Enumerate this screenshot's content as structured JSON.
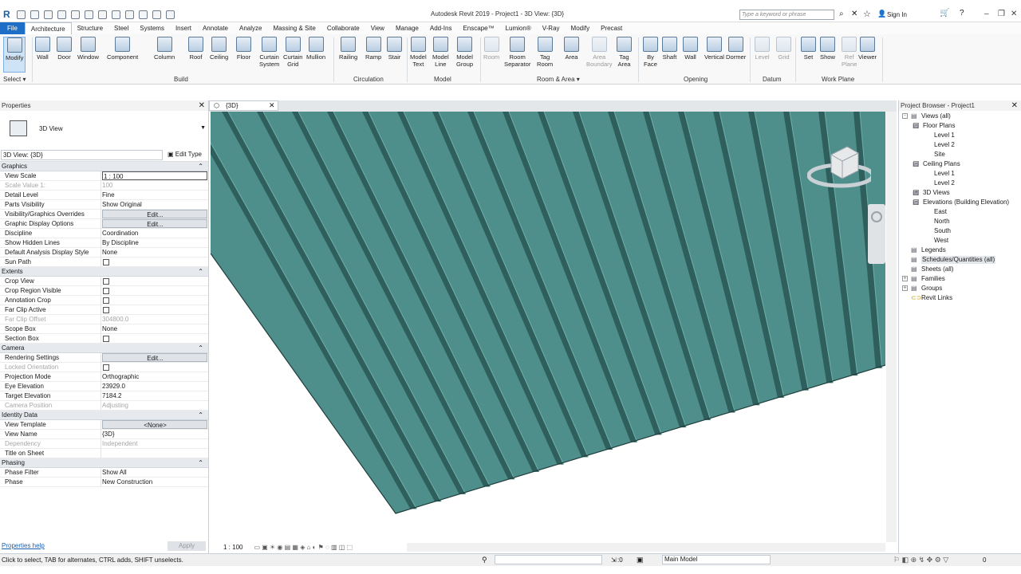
{
  "app": {
    "title": "Autodesk Revit 2019 - Project1 - 3D View: {3D}",
    "search_placeholder": "Type a keyword or phrase",
    "sign_in": "Sign In"
  },
  "tabs": [
    "File",
    "Architecture",
    "Structure",
    "Steel",
    "Systems",
    "Insert",
    "Annotate",
    "Analyze",
    "Massing & Site",
    "Collaborate",
    "View",
    "Manage",
    "Add-Ins",
    "Enscape™",
    "Lumion®",
    "V-Ray",
    "Modify",
    "Precast"
  ],
  "ribbon": {
    "buttons": [
      {
        "l1": "Modify",
        "l2": "",
        "enabled": true
      },
      {
        "l1": "Wall",
        "l2": "",
        "enabled": true
      },
      {
        "l1": "Door",
        "l2": "",
        "enabled": true
      },
      {
        "l1": "Window",
        "l2": "",
        "enabled": true
      },
      {
        "l1": "Component",
        "l2": "",
        "enabled": true
      },
      {
        "l1": "Column",
        "l2": "",
        "enabled": true
      },
      {
        "l1": "Roof",
        "l2": "",
        "enabled": true
      },
      {
        "l1": "Ceiling",
        "l2": "",
        "enabled": true
      },
      {
        "l1": "Floor",
        "l2": "",
        "enabled": true
      },
      {
        "l1": "Curtain",
        "l2": "System",
        "enabled": true
      },
      {
        "l1": "Curtain",
        "l2": "Grid",
        "enabled": true
      },
      {
        "l1": "Mullion",
        "l2": "",
        "enabled": true
      },
      {
        "l1": "Railing",
        "l2": "",
        "enabled": true
      },
      {
        "l1": "Ramp",
        "l2": "",
        "enabled": true
      },
      {
        "l1": "Stair",
        "l2": "",
        "enabled": true
      },
      {
        "l1": "Model",
        "l2": "Text",
        "enabled": true
      },
      {
        "l1": "Model",
        "l2": "Line",
        "enabled": true
      },
      {
        "l1": "Model",
        "l2": "Group",
        "enabled": true
      },
      {
        "l1": "Room",
        "l2": "",
        "enabled": false
      },
      {
        "l1": "Room",
        "l2": "Separator",
        "enabled": true
      },
      {
        "l1": "Tag",
        "l2": "Room",
        "enabled": true
      },
      {
        "l1": "Area",
        "l2": "",
        "enabled": true
      },
      {
        "l1": "Area",
        "l2": "Boundary",
        "enabled": false
      },
      {
        "l1": "Tag",
        "l2": "Area",
        "enabled": true
      },
      {
        "l1": "By",
        "l2": "Face",
        "enabled": true
      },
      {
        "l1": "Shaft",
        "l2": "",
        "enabled": true
      },
      {
        "l1": "Wall",
        "l2": "",
        "enabled": true
      },
      {
        "l1": "Vertical",
        "l2": "",
        "enabled": true
      },
      {
        "l1": "Dormer",
        "l2": "",
        "enabled": true
      },
      {
        "l1": "Level",
        "l2": "",
        "enabled": false
      },
      {
        "l1": "Grid",
        "l2": "",
        "enabled": false
      },
      {
        "l1": "Set",
        "l2": "",
        "enabled": true
      },
      {
        "l1": "Show",
        "l2": "",
        "enabled": true
      },
      {
        "l1": "Ref",
        "l2": "Plane",
        "enabled": false
      },
      {
        "l1": "Viewer",
        "l2": "",
        "enabled": true
      }
    ],
    "groups": [
      "Select ▾",
      "Build",
      "Circulation",
      "Model",
      "Room & Area ▾",
      "Opening",
      "Datum",
      "Work Plane"
    ]
  },
  "properties": {
    "title": "Properties",
    "type_name": "3D View",
    "instance": "3D View: {3D}",
    "edit_type": "Edit Type",
    "categories": [
      {
        "name": "Graphics",
        "rows": [
          {
            "k": "View Scale",
            "v": "1 : 100",
            "s": "box"
          },
          {
            "k": "Scale Value    1:",
            "v": "100",
            "s": "dim"
          },
          {
            "k": "Detail Level",
            "v": "Fine"
          },
          {
            "k": "Parts Visibility",
            "v": "Show Original"
          },
          {
            "k": "Visibility/Graphics Overrides",
            "v": "Edit...",
            "s": "btn"
          },
          {
            "k": "Graphic Display Options",
            "v": "Edit...",
            "s": "btn"
          },
          {
            "k": "Discipline",
            "v": "Coordination"
          },
          {
            "k": "Show Hidden Lines",
            "v": "By Discipline"
          },
          {
            "k": "Default Analysis Display Style",
            "v": "None"
          },
          {
            "k": "Sun Path",
            "v": "",
            "s": "chk"
          }
        ]
      },
      {
        "name": "Extents",
        "rows": [
          {
            "k": "Crop View",
            "v": "",
            "s": "chk"
          },
          {
            "k": "Crop Region Visible",
            "v": "",
            "s": "chk"
          },
          {
            "k": "Annotation Crop",
            "v": "",
            "s": "chk"
          },
          {
            "k": "Far Clip Active",
            "v": "",
            "s": "chk"
          },
          {
            "k": "Far Clip Offset",
            "v": "304800.0",
            "s": "dim"
          },
          {
            "k": "Scope Box",
            "v": "None"
          },
          {
            "k": "Section Box",
            "v": "",
            "s": "chk"
          }
        ]
      },
      {
        "name": "Camera",
        "rows": [
          {
            "k": "Rendering Settings",
            "v": "Edit...",
            "s": "btn"
          },
          {
            "k": "Locked Orientation",
            "v": "",
            "s": "dimchk"
          },
          {
            "k": "Projection Mode",
            "v": "Orthographic"
          },
          {
            "k": "Eye Elevation",
            "v": "23929.0"
          },
          {
            "k": "Target Elevation",
            "v": "7184.2"
          },
          {
            "k": "Camera Position",
            "v": "Adjusting",
            "s": "dim"
          }
        ]
      },
      {
        "name": "Identity Data",
        "rows": [
          {
            "k": "View Template",
            "v": "<None>",
            "s": "btn"
          },
          {
            "k": "View Name",
            "v": "{3D}"
          },
          {
            "k": "Dependency",
            "v": "Independent",
            "s": "dim"
          },
          {
            "k": "Title on Sheet",
            "v": ""
          }
        ]
      },
      {
        "name": "Phasing",
        "rows": [
          {
            "k": "Phase Filter",
            "v": "Show All"
          },
          {
            "k": "Phase",
            "v": "New Construction"
          }
        ]
      }
    ],
    "help": "Properties help",
    "apply": "Apply"
  },
  "view": {
    "tab": "{3D}",
    "scale": "1 : 100",
    "roof_color": "#4e8f8c",
    "rib_color": "#2f5f5c",
    "rib_light": "#6fb0ac"
  },
  "browser": {
    "title": "Project Browser - Project1",
    "items": [
      {
        "t": "Views (all)",
        "d": 0,
        "x": "-"
      },
      {
        "t": "Floor Plans",
        "d": 1,
        "x": "-"
      },
      {
        "t": "Level 1",
        "d": 2
      },
      {
        "t": "Level 2",
        "d": 2
      },
      {
        "t": "Site",
        "d": 2
      },
      {
        "t": "Ceiling Plans",
        "d": 1,
        "x": "-"
      },
      {
        "t": "Level 1",
        "d": 2
      },
      {
        "t": "Level 2",
        "d": 2
      },
      {
        "t": "3D Views",
        "d": 1,
        "x": "+"
      },
      {
        "t": "Elevations (Building Elevation)",
        "d": 1,
        "x": "-"
      },
      {
        "t": "East",
        "d": 2
      },
      {
        "t": "North",
        "d": 2
      },
      {
        "t": "South",
        "d": 2
      },
      {
        "t": "West",
        "d": 2
      },
      {
        "t": "Legends",
        "d": 0
      },
      {
        "t": "Schedules/Quantities (all)",
        "d": 0,
        "hl": true
      },
      {
        "t": "Sheets (all)",
        "d": 0
      },
      {
        "t": "Families",
        "d": 0,
        "x": "+"
      },
      {
        "t": "Groups",
        "d": 0,
        "x": "+"
      },
      {
        "t": "Revit Links",
        "d": 0,
        "link": true
      }
    ]
  },
  "status": {
    "text": "Click to select, TAB for alternates, CTRL adds, SHIFT unselects.",
    "zero": ":0",
    "model": "Main Model",
    "filter": "0"
  }
}
